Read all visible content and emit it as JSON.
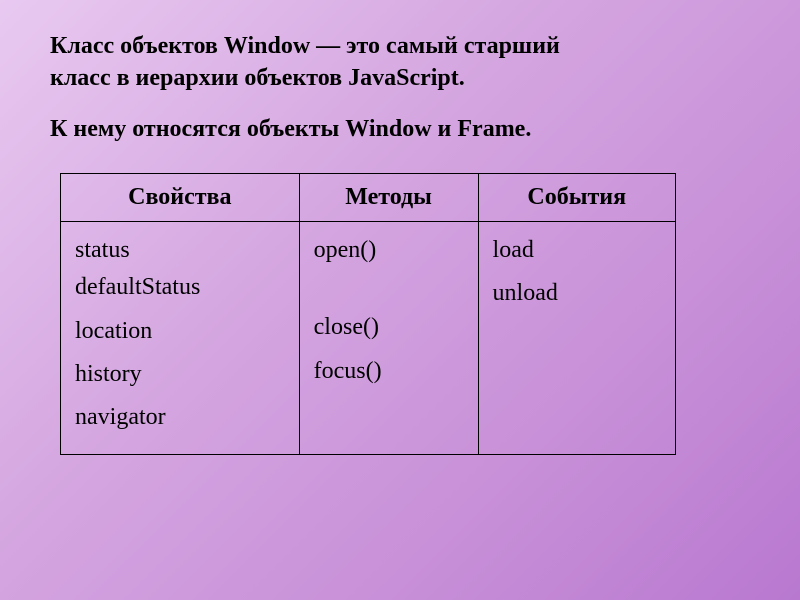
{
  "heading_line1": "Класс объектов Window — это самый старший",
  "heading_line2": "класс в иерархии объектов JavaScript.",
  "subheading": "К нему относятся объекты Window и Frame.",
  "table": {
    "headers": [
      "Свойства",
      "Методы",
      "События"
    ],
    "col0": [
      "status",
      "defaultStatus",
      "location",
      "history",
      "navigator"
    ],
    "col1": [
      "open()",
      "close()",
      "focus()"
    ],
    "col2": [
      "load",
      "unload"
    ]
  }
}
